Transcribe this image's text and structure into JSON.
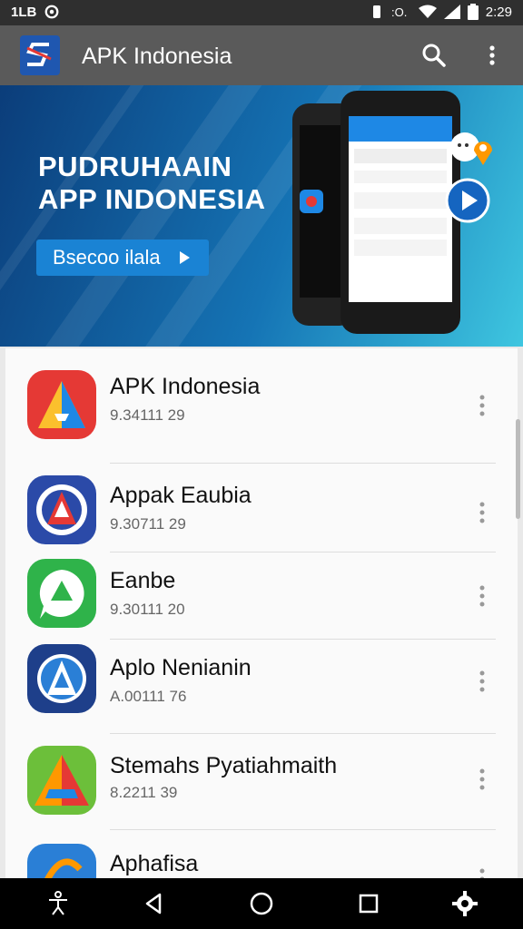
{
  "status": {
    "left_text": "1LB",
    "time": "2:29"
  },
  "appbar": {
    "title": "APK Indonesia"
  },
  "banner": {
    "line1": "PUDRUHAAIN",
    "line2": "APP INDONESIA",
    "cta": "Bsecoo ilala"
  },
  "apps": [
    {
      "name": "APK Indonesia",
      "sub": "9.34111 29",
      "icon_color": "#e53935"
    },
    {
      "name": "Appak Eaubia",
      "sub": "9.30711 29",
      "icon_color": "#2b4aa8"
    },
    {
      "name": "Eanbe",
      "sub": "9.30111 20",
      "icon_color": "#2fb34a"
    },
    {
      "name": "Aplo Nenianin",
      "sub": "A.00111 76",
      "icon_color": "#1e3f8a"
    },
    {
      "name": "Stemahs Pyatiahmaith",
      "sub": "8.2211 39",
      "icon_color": "#6cbf3a"
    },
    {
      "name": "Aphafisa",
      "sub": "",
      "icon_color": "#2a7fd6"
    }
  ],
  "icons": [
    "signal-icon",
    "wifi-icon",
    "battery-icon",
    "search-icon",
    "more-vert-icon",
    "back-icon",
    "home-icon",
    "recents-icon",
    "settings-icon",
    "accessibility-icon"
  ]
}
